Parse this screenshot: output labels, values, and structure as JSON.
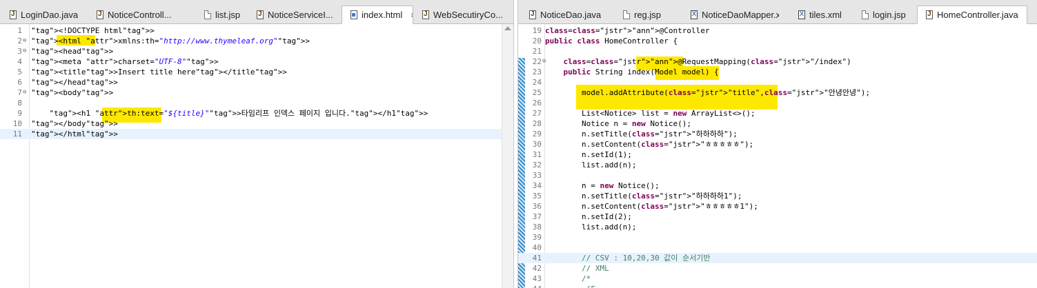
{
  "left_tabs": [
    {
      "label": "LoginDao.java",
      "icon": "java-file-icon"
    },
    {
      "label": "NoticeControll...",
      "icon": "java-file-icon"
    },
    {
      "label": "list.jsp",
      "icon": "jsp-file-icon"
    },
    {
      "label": "NoticeServiceI...",
      "icon": "java-file-icon"
    },
    {
      "label": "index.html",
      "icon": "html-file-icon",
      "active": true
    },
    {
      "label": "WebSecutiryCo...",
      "icon": "java-file-icon"
    }
  ],
  "right_tabs": [
    {
      "label": "NoticeDao.java",
      "icon": "java-file-icon"
    },
    {
      "label": "reg.jsp",
      "icon": "jsp-file-icon"
    },
    {
      "label": "NoticeDaoMapper.xml",
      "icon": "xml-file-icon"
    },
    {
      "label": "tiles.xml",
      "icon": "xml-file-icon"
    },
    {
      "label": "login.jsp",
      "icon": "jsp-file-icon"
    },
    {
      "label": "HomeController.java",
      "icon": "java-file-icon",
      "active": true
    }
  ],
  "close_glyph": "×",
  "left_lines": [
    {
      "n": "1",
      "t": "<!DOCTYPE html>"
    },
    {
      "n": "2",
      "t": "<html xmlns:th=\"http://www.thymeleaf.org\">"
    },
    {
      "n": "3",
      "t": "<head>"
    },
    {
      "n": "4",
      "t": "<meta charset=\"UTF-8\">"
    },
    {
      "n": "5",
      "t": "<title>Insert title here</title>"
    },
    {
      "n": "6",
      "t": "</head>"
    },
    {
      "n": "7",
      "t": "<body>"
    },
    {
      "n": "8",
      "t": ""
    },
    {
      "n": "9",
      "t": "    <h1 th:text=\"${title}\">타임리프 인덱스 페이지 입니다.</h1>"
    },
    {
      "n": "10",
      "t": "</body>"
    },
    {
      "n": "11",
      "t": "</html>"
    }
  ],
  "right_lines": [
    {
      "n": "19",
      "t": "@Controller"
    },
    {
      "n": "20",
      "t": "public class HomeController {"
    },
    {
      "n": "21",
      "t": ""
    },
    {
      "n": "22",
      "t": "    @RequestMapping(\"/index\")"
    },
    {
      "n": "23",
      "t": "    public String index(Model model) {"
    },
    {
      "n": "24",
      "t": ""
    },
    {
      "n": "25",
      "t": "        model.addAttribute(\"title\",\"안녕안녕\");"
    },
    {
      "n": "26",
      "t": ""
    },
    {
      "n": "27",
      "t": "        List<Notice> list = new ArrayList<>();"
    },
    {
      "n": "28",
      "t": "        Notice n = new Notice();"
    },
    {
      "n": "29",
      "t": "        n.setTitle(\"하하하하\");"
    },
    {
      "n": "30",
      "t": "        n.setContent(\"ㅎㅎㅎㅎㅎ\");"
    },
    {
      "n": "31",
      "t": "        n.setId(1);"
    },
    {
      "n": "32",
      "t": "        list.add(n);"
    },
    {
      "n": "33",
      "t": ""
    },
    {
      "n": "34",
      "t": "        n = new Notice();"
    },
    {
      "n": "35",
      "t": "        n.setTitle(\"하하하하1\");"
    },
    {
      "n": "36",
      "t": "        n.setContent(\"ㅎㅎㅎㅎㅎ1\");"
    },
    {
      "n": "37",
      "t": "        n.setId(2);"
    },
    {
      "n": "38",
      "t": "        list.add(n);"
    },
    {
      "n": "39",
      "t": ""
    },
    {
      "n": "40",
      "t": ""
    },
    {
      "n": "41",
      "t": "        // CSV : 10,20,30 값이 순서기반"
    },
    {
      "n": "42",
      "t": "        // XML"
    },
    {
      "n": "43",
      "t": "        /*"
    },
    {
      "n": "44",
      "t": "         {F"
    }
  ],
  "colors": {
    "highlight": "#ffe800",
    "tag": "#3f7f7f",
    "attr": "#7f007f",
    "string": "#2a00ff",
    "keyword": "#7f0055",
    "comment": "#3f7f5f",
    "current_line": "#e8f2fe"
  }
}
